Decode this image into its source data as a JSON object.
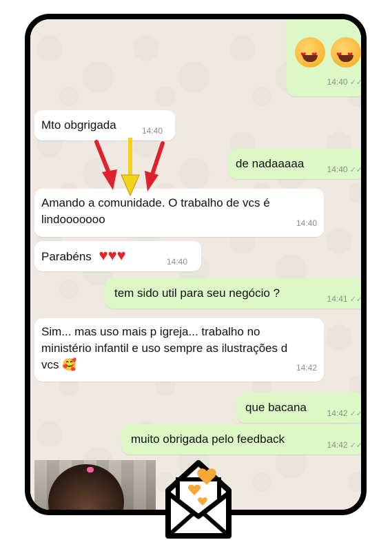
{
  "messages": [
    {
      "dir": "out",
      "text": "",
      "emoji": "heart-eyes-face x2",
      "time": "14:40",
      "ticks": "✓✓"
    },
    {
      "dir": "in",
      "text": "Mto obgrigada",
      "time": "14:40"
    },
    {
      "dir": "out",
      "text": "de nadaaaaa",
      "time": "14:40",
      "ticks": "✓✓"
    },
    {
      "dir": "in",
      "text": "Amando a comunidade. O trabalho de vcs é lindooooooo",
      "time": "14:40"
    },
    {
      "dir": "in",
      "text": "Parabéns",
      "emoji": "❤️❤️❤️",
      "time": "14:40"
    },
    {
      "dir": "out",
      "text": "tem sido util para seu negócio ?",
      "time": "14:41",
      "ticks": "✓✓"
    },
    {
      "dir": "in",
      "text": "Sim... mas uso mais p igreja... trabalho no ministério infantil e uso sempre as ilustrações d vcs 🥰",
      "time": "14:42"
    },
    {
      "dir": "out",
      "text": "que bacana",
      "time": "14:42",
      "ticks": "✓✓"
    },
    {
      "dir": "out",
      "text": "muito obrigada pelo feedback",
      "time": "14:42",
      "ticks": "✓✓"
    }
  ],
  "colors": {
    "incoming": "#ffffff",
    "outgoing": "#dcf8c6",
    "background": "#efe9e1",
    "arrow_red": "#e0202c",
    "arrow_yellow": "#f4d21a",
    "frame": "#000000"
  },
  "icons": [
    "heart-eyes-emoji",
    "heart-emoji",
    "smiling-face-with-hearts-emoji",
    "double-check-icon",
    "envelope-icon"
  ]
}
